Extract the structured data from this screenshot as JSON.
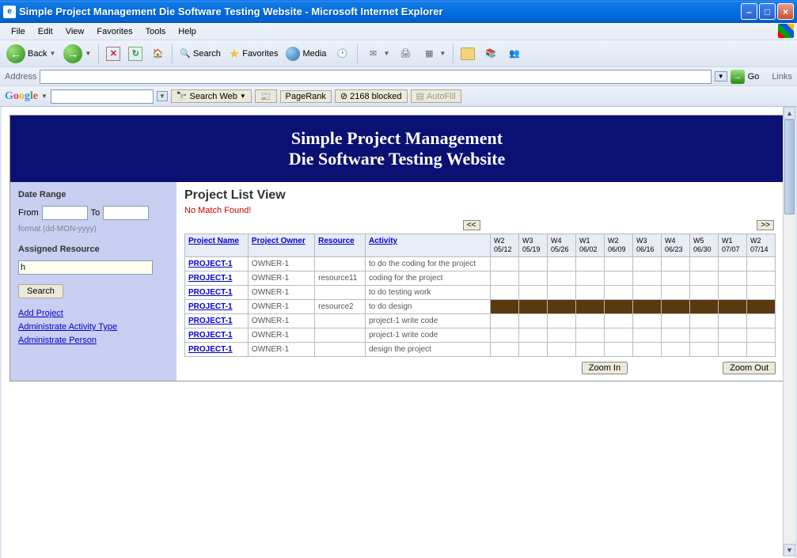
{
  "window": {
    "title": "Simple Project Management Die Software Testing Website - Microsoft Internet Explorer"
  },
  "menubar": [
    "File",
    "Edit",
    "View",
    "Favorites",
    "Tools",
    "Help"
  ],
  "toolbar": {
    "back": "Back",
    "search": "Search",
    "favorites": "Favorites",
    "media": "Media"
  },
  "addressbar": {
    "label": "Address",
    "value": "",
    "go": "Go",
    "links": "Links"
  },
  "googlebar": {
    "search_web": "Search Web",
    "pagerank": "PageRank",
    "blocked": "2168 blocked",
    "autofill": "AutoFill"
  },
  "page": {
    "header_line1": "Simple Project Management",
    "header_line2": "Die Software Testing Website"
  },
  "sidebar": {
    "date_range_title": "Date Range",
    "from_label": "From",
    "to_label": "To",
    "from_value": "",
    "to_value": "",
    "format_hint": "format (dd-MON-yyyy)",
    "assigned_resource_title": "Assigned Resource",
    "assigned_resource_value": "h",
    "search_btn": "Search",
    "links": {
      "add_project": "Add Project",
      "admin_activity": "Administrate Activity Type",
      "admin_person": "Administrate Person"
    }
  },
  "main": {
    "title": "Project List View",
    "no_match": "No Match Found!",
    "prev": "<<",
    "next": ">>",
    "headers": {
      "project_name": "Project Name",
      "project_owner": "Project Owner",
      "resource": "Resource",
      "activity": "Activity"
    },
    "weeks": [
      {
        "w": "W2",
        "d": "05/12"
      },
      {
        "w": "W3",
        "d": "05/19"
      },
      {
        "w": "W4",
        "d": "05/26"
      },
      {
        "w": "W1",
        "d": "06/02"
      },
      {
        "w": "W2",
        "d": "06/09"
      },
      {
        "w": "W3",
        "d": "06/16"
      },
      {
        "w": "W4",
        "d": "06/23"
      },
      {
        "w": "W5",
        "d": "06/30"
      },
      {
        "w": "W1",
        "d": "07/07"
      },
      {
        "w": "W2",
        "d": "07/14"
      }
    ],
    "rows": [
      {
        "project": "PROJECT-1",
        "owner": "OWNER-1",
        "resource": "",
        "activity": "to do the coding for the project",
        "filled": false
      },
      {
        "project": "PROJECT-1",
        "owner": "OWNER-1",
        "resource": "resource11",
        "activity": "coding for the project",
        "filled": false
      },
      {
        "project": "PROJECT-1",
        "owner": "OWNER-1",
        "resource": "",
        "activity": "to do testing work",
        "filled": false
      },
      {
        "project": "PROJECT-1",
        "owner": "OWNER-1",
        "resource": "resource2",
        "activity": "to do design",
        "filled": true
      },
      {
        "project": "PROJECT-1",
        "owner": "OWNER-1",
        "resource": "",
        "activity": "project-1 write code",
        "filled": false
      },
      {
        "project": "PROJECT-1",
        "owner": "OWNER-1",
        "resource": "",
        "activity": "project-1 write code",
        "filled": false
      },
      {
        "project": "PROJECT-1",
        "owner": "OWNER-1",
        "resource": "",
        "activity": "design the project",
        "filled": false
      }
    ],
    "zoom_in": "Zoom In",
    "zoom_out": "Zoom Out"
  }
}
